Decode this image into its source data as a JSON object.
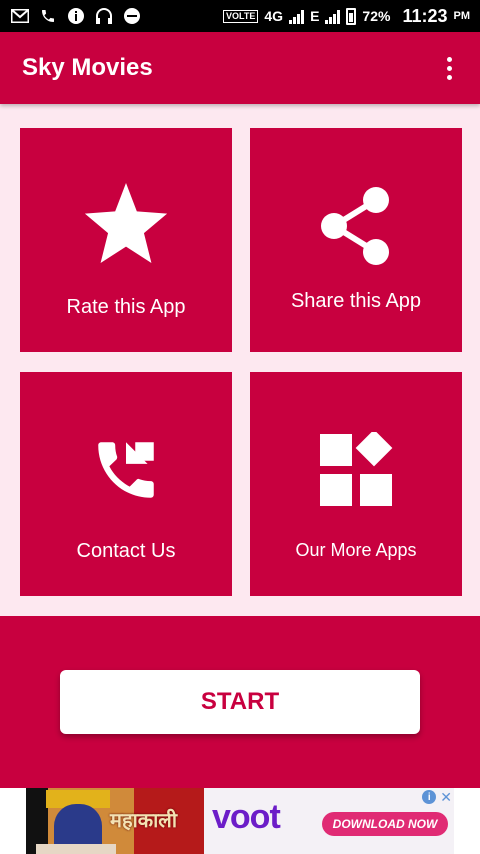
{
  "status_bar": {
    "network_badge": "VOLTE",
    "network_type": "4G",
    "network_type_2": "E",
    "battery": "72%",
    "time": "11:23",
    "time_suffix": "PM"
  },
  "app_bar": {
    "title": "Sky Movies"
  },
  "tiles": [
    {
      "label": "Rate this App",
      "icon": "star-icon"
    },
    {
      "label": "Share this App",
      "icon": "share-icon"
    },
    {
      "label": "Contact Us",
      "icon": "phone-forward-icon"
    },
    {
      "label": "Our More Apps",
      "icon": "apps-grid-icon"
    }
  ],
  "start_button": {
    "label": "START"
  },
  "ad": {
    "hindi_text": "महाकाली",
    "brand": "voot",
    "cta": "DOWNLOAD NOW",
    "info": "i",
    "close": "✕"
  },
  "colors": {
    "primary": "#c8003f",
    "background": "#fde8f0",
    "ad_brand": "#6c1dc8",
    "ad_cta": "#e02b74"
  }
}
